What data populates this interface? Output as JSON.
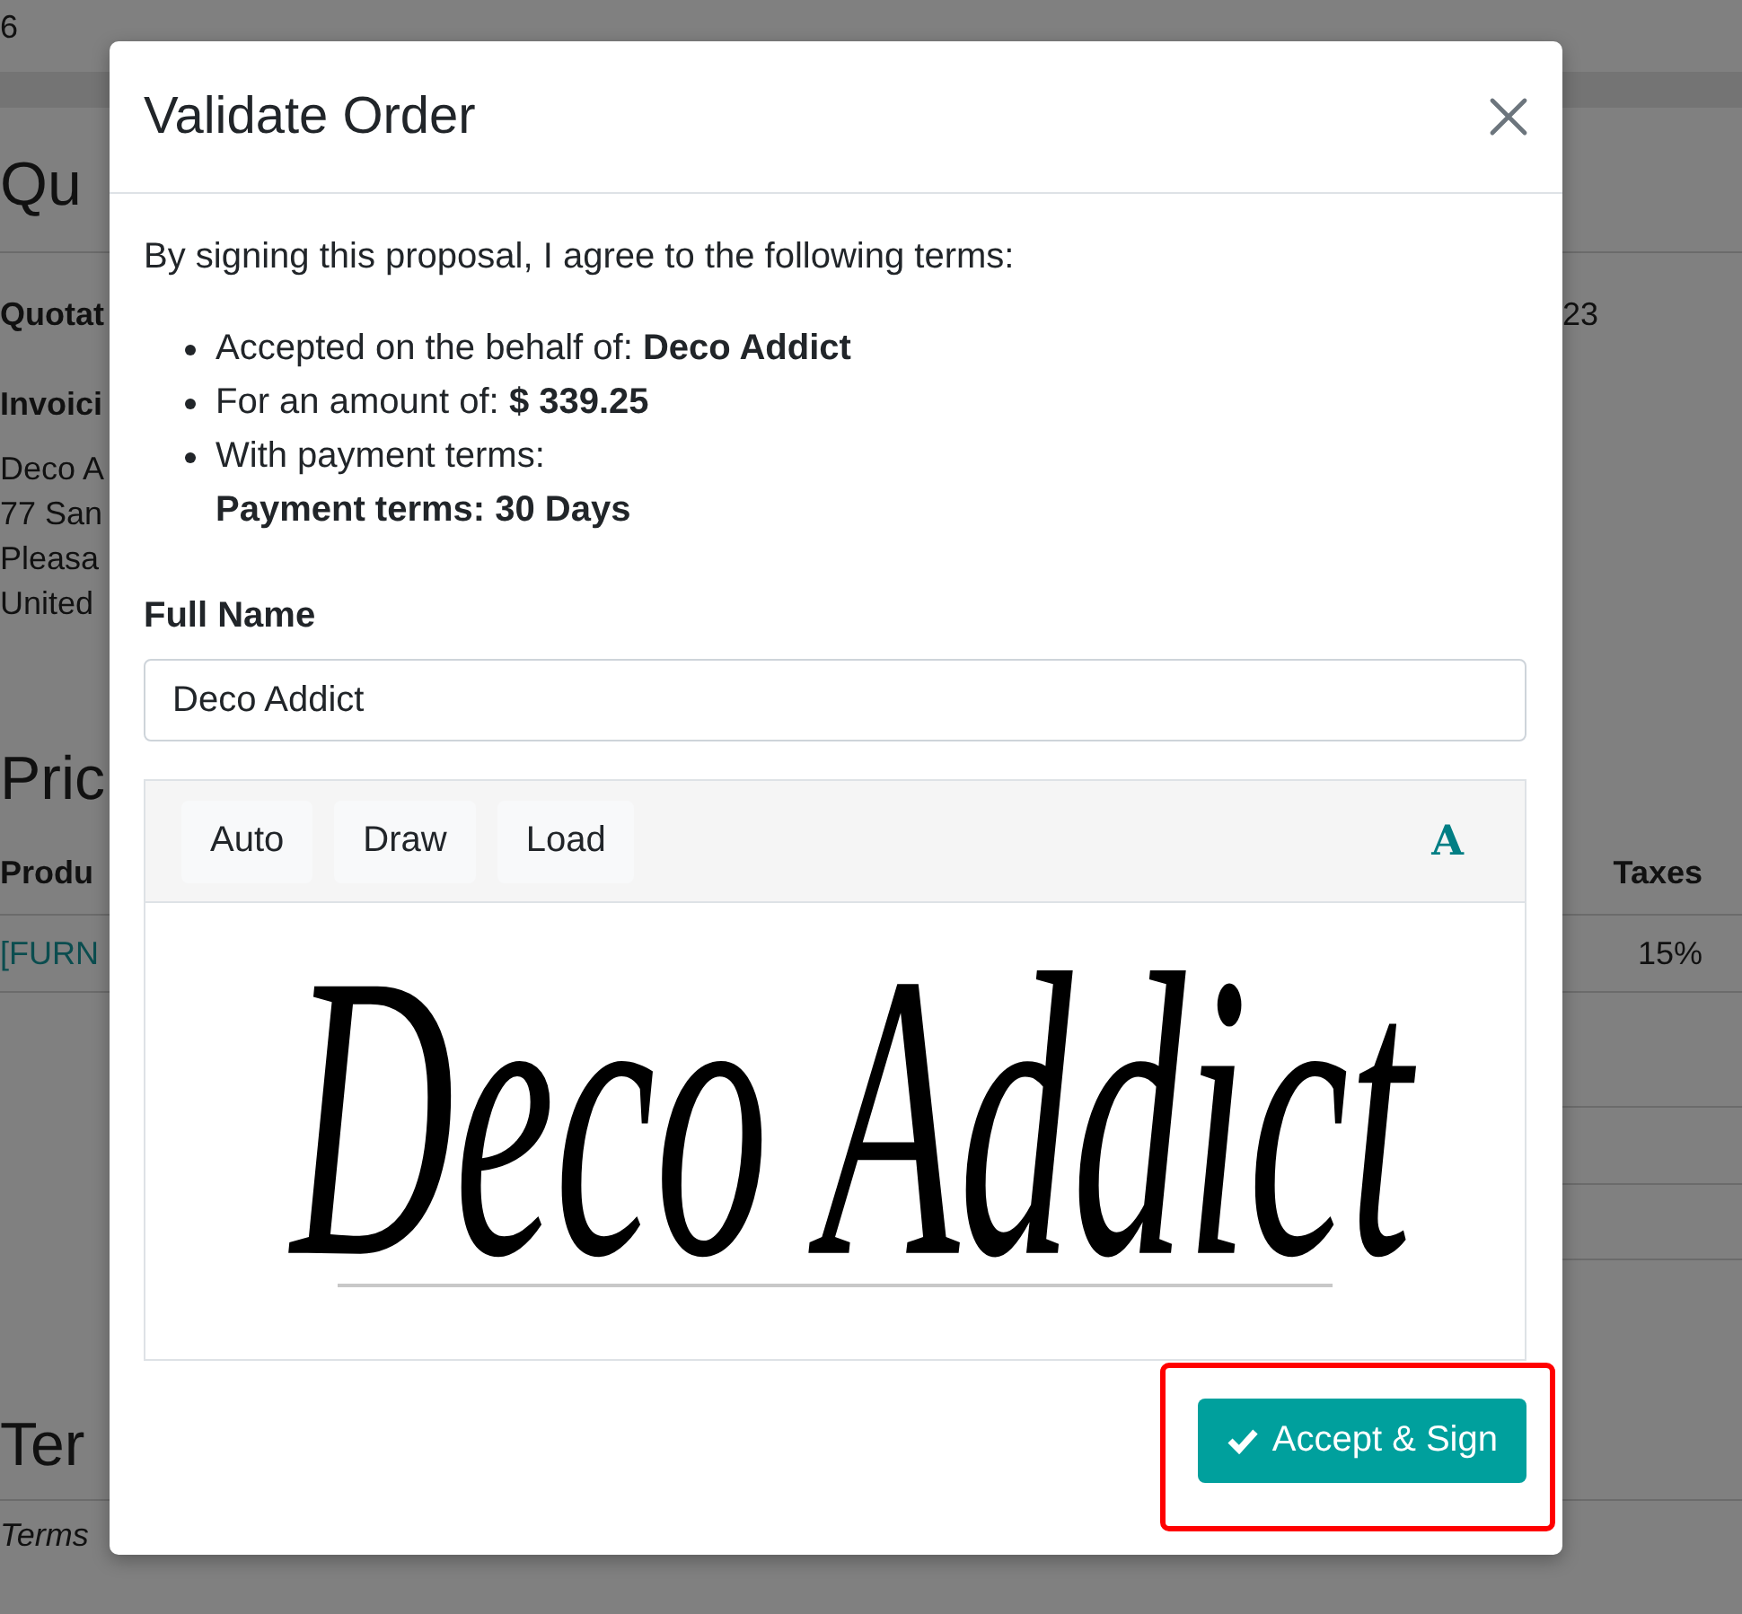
{
  "background_page": {
    "top_text": "6",
    "title": "Qu",
    "quotation_label": "Quotat",
    "date_fragment": "23",
    "invoicing_label": "Invoici",
    "address_lines": [
      "Deco A",
      "77 San",
      "Pleasa",
      "United"
    ],
    "pricing_title": "Pric",
    "table": {
      "columns": [
        {
          "label": "Produ"
        },
        {
          "label": "Taxes"
        }
      ],
      "rows": [
        {
          "cells": [
            "[FURN",
            "15%"
          ]
        }
      ]
    },
    "terms_title": "Ter",
    "terms_text": "Terms"
  },
  "dialog": {
    "title": "Validate Order",
    "intro": "By signing this proposal, I agree to the following terms:",
    "terms": [
      {
        "label": "Accepted on the behalf of:",
        "value": "Deco Addict",
        "value_below": false
      },
      {
        "label": "For an amount of:",
        "value": "$ 339.25",
        "value_below": false
      },
      {
        "label": "With payment terms:",
        "value": "Payment terms: 30 Days",
        "value_below": true
      }
    ],
    "full_name": {
      "label": "Full Name",
      "value": "Deco Addict"
    },
    "signature": {
      "modes": [
        {
          "label": "Auto"
        },
        {
          "label": "Draw"
        },
        {
          "label": "Load"
        }
      ],
      "font_button": "A",
      "text": "Deco Addict"
    },
    "accept_button": {
      "label": "Accept & Sign",
      "highlighted": true
    }
  }
}
